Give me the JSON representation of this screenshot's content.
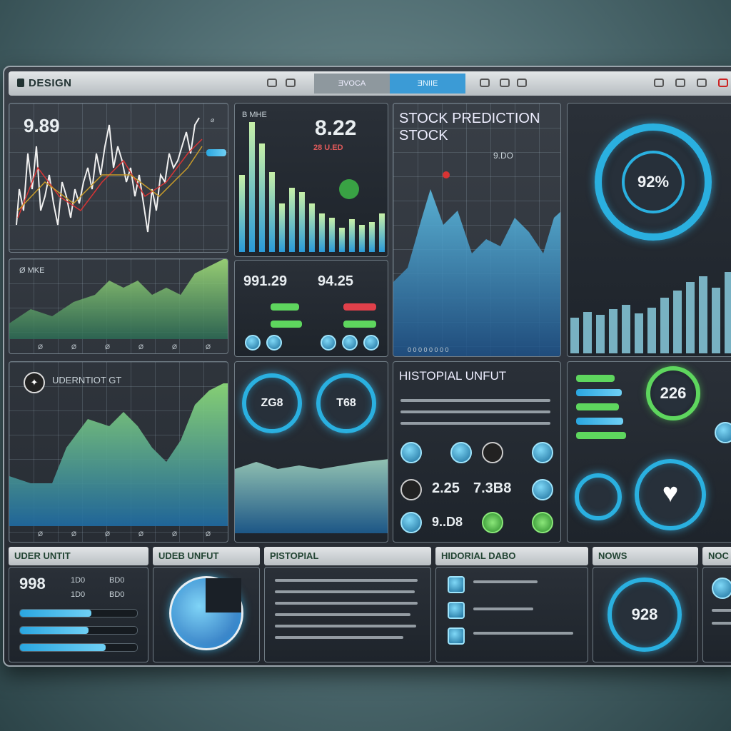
{
  "window": {
    "brand": "DESIGN",
    "tabs": [
      "ƎVOCA",
      "ƎNIIE"
    ]
  },
  "p1": {
    "value": "9.89"
  },
  "p2": {
    "value": "8.22",
    "sub": "28 U.ED",
    "label": "B MHE"
  },
  "p3": {
    "title_line1": "STOCK PREDICTION",
    "title_line2": "STOCK",
    "sub": "9.DO"
  },
  "p4": {
    "gauge": "92%"
  },
  "p5": {
    "label": "Ø MKE",
    "ticks": [
      "Ø",
      "Ø",
      "Ø",
      "Ø",
      "Ø",
      "Ø"
    ]
  },
  "p6": {
    "left": "991.29",
    "right": "94.25"
  },
  "p7": {
    "label": "UDERNTIOT GT"
  },
  "p8": {
    "ring1": "ZG8",
    "ring2": "T68"
  },
  "p9": {
    "title": "HISTOPIAL UNFUT",
    "values": [
      "2.25",
      "7.3B8",
      "9..D8"
    ]
  },
  "p10": {
    "big": "226"
  },
  "bottom": {
    "user_input": {
      "header": "UDER UNTIT",
      "value": "998",
      "cols": [
        "1D0",
        "BD0",
        "1D0",
        "BD0"
      ]
    },
    "user_unfut": {
      "header": "UDEB UNFUT"
    },
    "historial": {
      "header": "PISTOPIAL"
    },
    "hidoral": {
      "header": "HIDORIAL DABO"
    },
    "news1": {
      "header": "NOWS",
      "value": "928"
    },
    "news2": {
      "header": "NOC"
    }
  },
  "colors": {
    "accent": "#2ab0e0",
    "green": "#5ed65e",
    "red": "#e0404a"
  },
  "icons": [
    "logo-icon",
    "settings-icon",
    "heart-icon",
    "chart-icon",
    "close-icon"
  ]
}
